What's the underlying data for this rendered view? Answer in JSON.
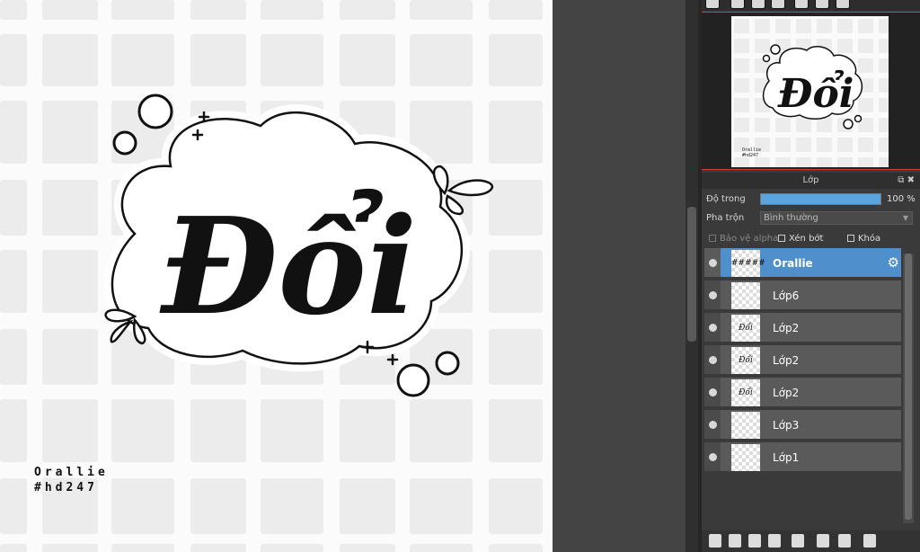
{
  "canvas": {
    "artwork_text": "Đổi",
    "signature_lines": [
      "Orallie",
      "#hd247"
    ]
  },
  "navigator": {
    "toolbar_icons": [
      "zoom-fit-icon",
      "zoom-in-icon",
      "actual-size-icon",
      "zoom-out-icon",
      "rotate-left-icon",
      "flip-icon",
      "rotate-right-icon"
    ],
    "thumbnail_text": "Đổi",
    "thumbnail_signature": [
      "Orallie",
      "#hd247"
    ]
  },
  "layers_panel": {
    "title": "Lớp",
    "header_icons": [
      "⧉",
      "✖"
    ],
    "opacity_label": "Độ trong",
    "opacity_value": "100 %",
    "opacity_fraction": 1.0,
    "blend_label": "Pha trộn",
    "blend_value": "Bình thường",
    "protect_alpha_label": "Bảo vệ alpha",
    "clipping_label": "Xén bớt",
    "lock_label": "Khóa",
    "layers": [
      {
        "name": "Orallie",
        "thumb": "#####",
        "selected": true
      },
      {
        "name": "Lớp6",
        "thumb": "",
        "selected": false
      },
      {
        "name": "Lớp2",
        "thumb": "Đổi",
        "selected": false
      },
      {
        "name": "Lớp2",
        "thumb": "Đổi",
        "selected": false
      },
      {
        "name": "Lớp2",
        "thumb": "Đổi",
        "selected": false
      },
      {
        "name": "Lớp3",
        "thumb": "",
        "selected": false
      },
      {
        "name": "Lớp1",
        "thumb": "",
        "selected": false
      }
    ],
    "bottom_toolbar_icons": [
      "new-layer-icon",
      "new-layer-8bit-icon",
      "new-layer-1bit-icon",
      "new-halftone-layer-icon",
      "new-folder-icon",
      "duplicate-layer-icon",
      "merge-down-icon",
      "delete-layer-icon"
    ]
  }
}
